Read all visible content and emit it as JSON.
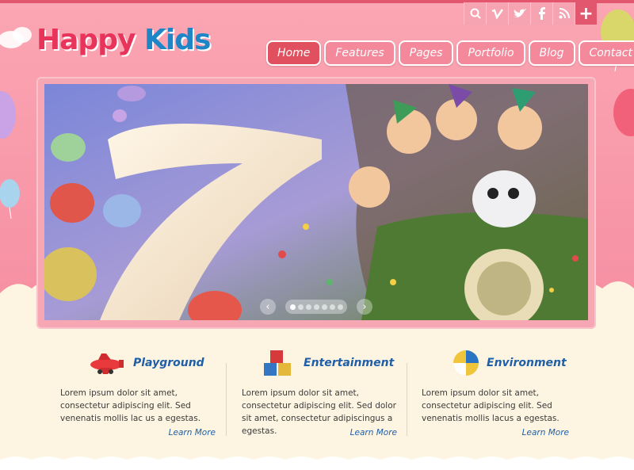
{
  "logo": {
    "word1": "Happy",
    "word2": "Kids"
  },
  "social": [
    {
      "icon": "search-icon"
    },
    {
      "icon": "vimeo-icon"
    },
    {
      "icon": "twitter-icon"
    },
    {
      "icon": "facebook-icon"
    },
    {
      "icon": "rss-icon"
    },
    {
      "icon": "plus-icon",
      "glyph": "+"
    }
  ],
  "nav": [
    {
      "label": "Home",
      "active": true
    },
    {
      "label": "Features"
    },
    {
      "label": "Pages"
    },
    {
      "label": "Portfolio"
    },
    {
      "label": "Blog"
    },
    {
      "label": "Contact"
    }
  ],
  "slider": {
    "arrow_prev": "‹",
    "arrow_next": "›",
    "active_dot": 0,
    "dot_count": 7
  },
  "features": [
    {
      "title": "Playground",
      "icon": "airplane-icon",
      "body": "Lorem ipsum dolor sit amet, consectetur adipiscing elit. Sed venenatis mollis lac us a egestas.",
      "link": "Learn More"
    },
    {
      "title": "Entertainment",
      "icon": "toy-blocks-icon",
      "body": "Lorem ipsum dolor sit amet, consectetur adipiscing elit. Sed dolor sit amet, consectetur adipiscingus a egestas.",
      "link": "Learn More"
    },
    {
      "title": "Environment",
      "icon": "globe-ball-icon",
      "body": "Lorem ipsum dolor sit amet, consectetur adipiscing elit. Sed venenatis mollis lacus a egestas.",
      "link": "Learn More"
    }
  ],
  "colors": {
    "brand_pink": "#f690a3",
    "nav_active": "#e0505f",
    "title_blue": "#1f5fa8",
    "cream": "#fdf5e1"
  }
}
